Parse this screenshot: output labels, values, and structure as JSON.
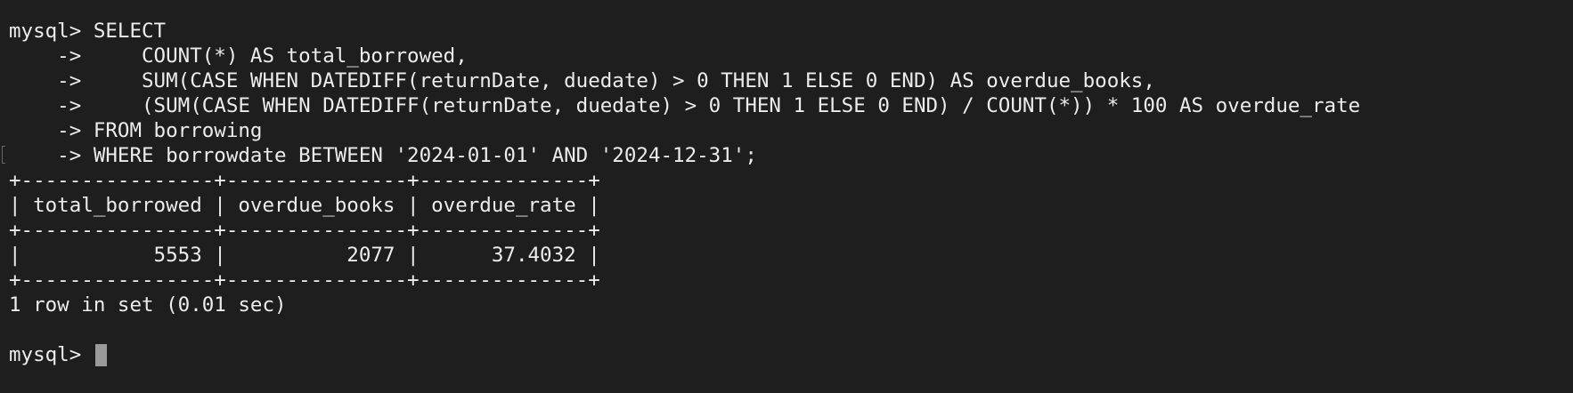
{
  "terminal": {
    "query_lines": [
      "mysql> SELECT",
      "    ->     COUNT(*) AS total_borrowed,",
      "    ->     SUM(CASE WHEN DATEDIFF(returnDate, duedate) > 0 THEN 1 ELSE 0 END) AS overdue_books,",
      "    ->     (SUM(CASE WHEN DATEDIFF(returnDate, duedate) > 0 THEN 1 ELSE 0 END) / COUNT(*)) * 100 AS overdue_rate",
      "    -> FROM borrowing",
      "    -> WHERE borrowdate BETWEEN '2024-01-01' AND '2024-12-31';"
    ],
    "result_table": {
      "border_top": "+----------------+---------------+--------------+",
      "header_row": "| total_borrowed | overdue_books | overdue_rate |",
      "border_mid": "+----------------+---------------+--------------+",
      "data_row": "|           5553 |          2077 |      37.4032 |",
      "border_bottom": "+----------------+---------------+--------------+",
      "columns": [
        "total_borrowed",
        "overdue_books",
        "overdue_rate"
      ],
      "rows": [
        [
          "5553",
          "2077",
          "37.4032"
        ]
      ]
    },
    "status_line": "1 row in set (0.01 sec)",
    "prompt": "mysql> "
  },
  "colors": {
    "background": "#1e1e1e",
    "foreground": "#ececec",
    "cursor": "#9a9a9a"
  }
}
